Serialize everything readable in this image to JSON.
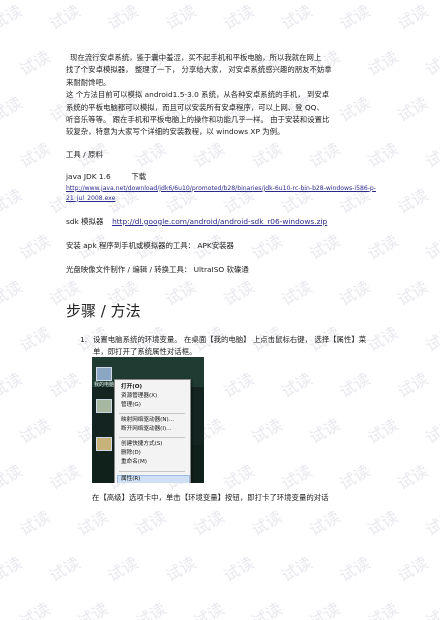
{
  "watermark": "试读",
  "intro": {
    "lines": [
      "现在流行安卓系统，鉴于囊中羞涩，买不起手机和平板电脑，所以我就在网上",
      "找了个安卓模拟器， 整理了一下， 分享给大家， 对安卓系统感兴趣的朋友不妨拿",
      "来耐耐馋吧。",
      "这 个方法目前可以模拟  android1.5-3.0   系统，从各种安卓系统的手机， 到安卓",
      "系统的平板电脑都可以模拟，而且可以安装所有安卓程序，可以上网、登      QQ、",
      "听音乐等等。 跟在手机和平板电脑上的操作和功能几乎一样。    由于安装和设置比",
      "较复杂，特意为大家写个详细的安装教程，以      windows XP 为例。"
    ]
  },
  "tools_heading": "工具 / 原料",
  "jdk": {
    "name": "java JDK 1.6",
    "action": "下载",
    "url": "http://www.java.net/download/jdk6/6u10/promoted/b28/binaries/jdk-6u10-rc-bin-b28-windows-i586-p-21_jul_2008.exe"
  },
  "sdk": {
    "label": "sdk 模拟器",
    "url": "http://dl.google.com/android/android-sdk_r06-windows.zip"
  },
  "apk_line": "安装 apk 程序到手机或模拟器的工具：    APK安装器",
  "iso_line": "光盘映像文件制作  / 编辑 / 转换工具：  UltraISO  软碟通",
  "steps_heading": "步骤 / 方法",
  "step1": {
    "number": "1.",
    "text": "设置电脑系统的环境变量。  在桌面【我的电脑】 上点击鼠标右键， 选择【属性】菜单，即打开了系统属性对话框。"
  },
  "screenshot": {
    "desktop_label": "我的电脑",
    "menu_items": [
      "打开(O)",
      "资源管理器(X)",
      "管理(G)",
      "映射网络驱动器(N)...",
      "断开网络驱动器(I)...",
      "创建快捷方式(S)",
      "删除(D)",
      "重命名(M)",
      "属性(R)"
    ]
  },
  "caption": "在【高级】选项卡中，单击【环境变量】按钮，即打卡了环境变量的对话"
}
